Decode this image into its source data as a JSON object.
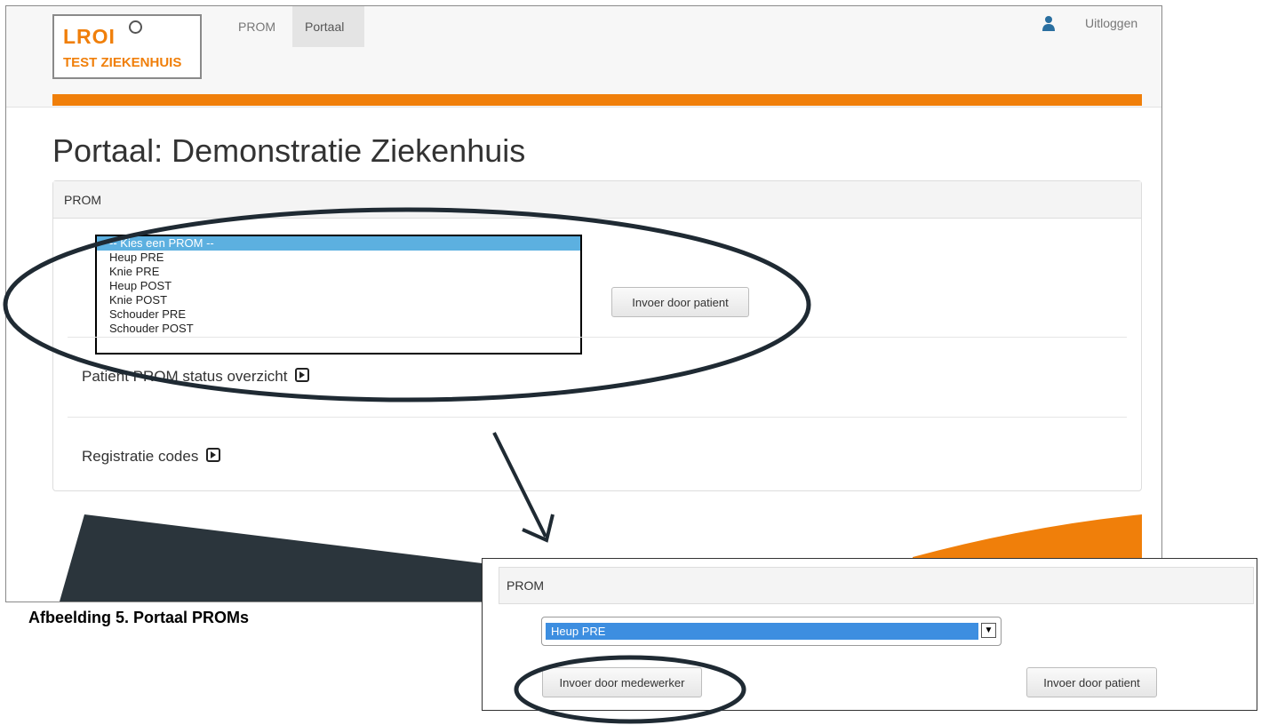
{
  "navbar": {
    "logo_text": "LROI",
    "logo_subtitle": "TEST ZIEKENHUIS",
    "nav_items": [
      "PROM",
      "Portaal"
    ],
    "active_item": "Portaal",
    "logout_label": "Uitloggen",
    "user_icon": "user-icon"
  },
  "page": {
    "title": "Portaal: Demonstratie Ziekenhuis"
  },
  "prom_panel": {
    "heading": "PROM",
    "select_options": [
      "-- Kies een PROM --",
      "Heup PRE",
      "Knie PRE",
      "Heup POST",
      "Knie POST",
      "Schouder PRE",
      "Schouder POST"
    ],
    "selected_option": "-- Kies een PROM --",
    "patient_button": "Invoer door patient",
    "status_link": "Patient PROM status overzicht",
    "codes_link": "Registratie codes",
    "link_icon": "external-link-icon"
  },
  "zoom_panel": {
    "heading": "PROM",
    "selected_value": "Heup PRE",
    "employee_button": "Invoer door medewerker",
    "patient_button": "Invoer door patient"
  },
  "caption": "Afbeelding 5. Portaal PROMs",
  "colors": {
    "accent_orange": "#f07f0a",
    "dark_shape": "#2b353c",
    "selected_blue": "#5cb0e0",
    "zoom_selected_blue": "#3d8ee0"
  }
}
